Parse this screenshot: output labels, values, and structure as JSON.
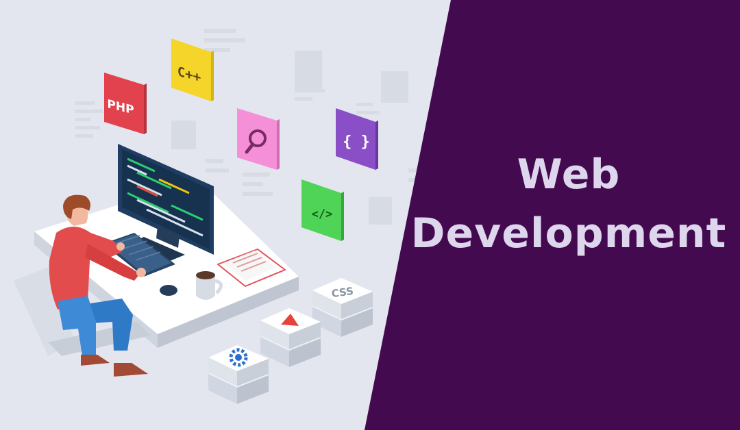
{
  "headline": {
    "line1": "Web",
    "line2": "Development"
  },
  "badges": {
    "php": "PHP",
    "cpp": "C++",
    "braces": "{ }",
    "code_tag": "</>",
    "css": "CSS"
  },
  "icons": [
    "php-badge-icon",
    "cpp-badge-icon",
    "search-badge-icon",
    "braces-badge-icon",
    "code-tag-badge-icon",
    "css-tile-icon",
    "play-tile-icon",
    "gear-tile-icon",
    "coffee-mug-icon",
    "monitor-icon",
    "keyboard-icon",
    "mouse-icon",
    "developer-figure",
    "chair-icon"
  ],
  "colors": {
    "background": "#e3e6ee",
    "panel": "#440a4f",
    "headline_text": "#ddd6ec",
    "php": "#e2424e",
    "cpp": "#f6d52a",
    "search": "#f58fd7",
    "braces": "#8a4fc6",
    "code_tag": "#4fd457",
    "play": "#e8423c",
    "gear": "#2a6ecf",
    "shirt": "#e24c4c",
    "jeans": "#2f7ac6"
  }
}
